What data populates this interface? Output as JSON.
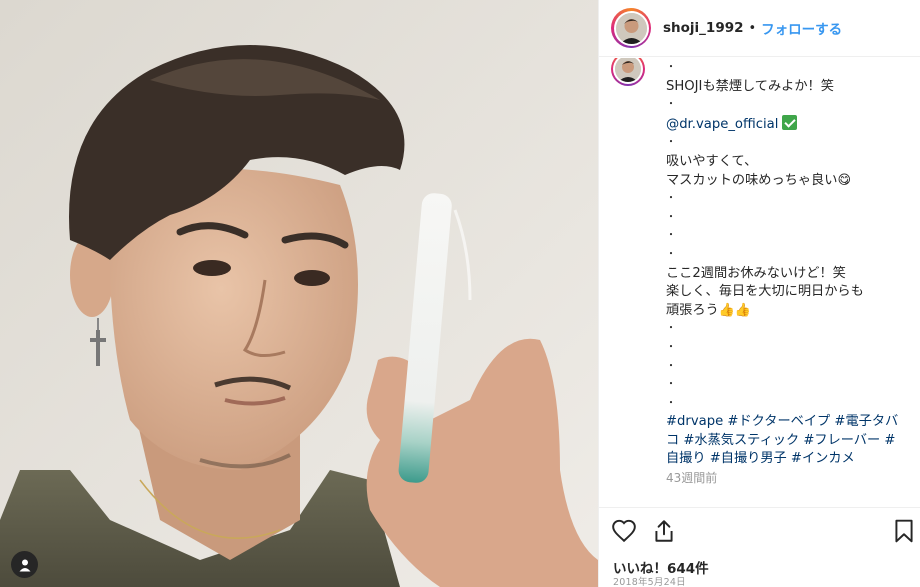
{
  "header": {
    "username": "shoji_1992",
    "separator": "•",
    "follow_label": "フォローする"
  },
  "caption": {
    "bullet": "・",
    "line_1": "SHOJIも禁煙してみよか！笑",
    "mention": "@dr.vape_official",
    "line_2": "吸いやすくて、",
    "line_3": "マスカットの味めっちゃ良い",
    "line_4": "ここ2週間お休みないけど！笑",
    "line_5": "楽しく、毎日を大切に明日からも",
    "line_6": "頑張ろう",
    "hashtags": "#drvape #ドクターベイプ #電子タバコ #水蒸気スティック #フレーバー #自撮り #自撮り男子 #インカメ"
  },
  "icons": {
    "user_tag": "person-tag-icon",
    "like": "heart-outline-icon",
    "share": "share-upload-icon",
    "save": "bookmark-outline-icon",
    "verified": "check-mark-button-icon",
    "emoji_savoring": "yum-face-emoji",
    "emoji_thumbs": "thumbs-up-emoji"
  },
  "meta": {
    "time_ago": "43週間前",
    "likes": "いいね！644件",
    "date": "2018年5月24日"
  },
  "colors": {
    "link": "#003569",
    "follow": "#3897f0",
    "muted": "#999999",
    "verified": "#3fa64a"
  }
}
